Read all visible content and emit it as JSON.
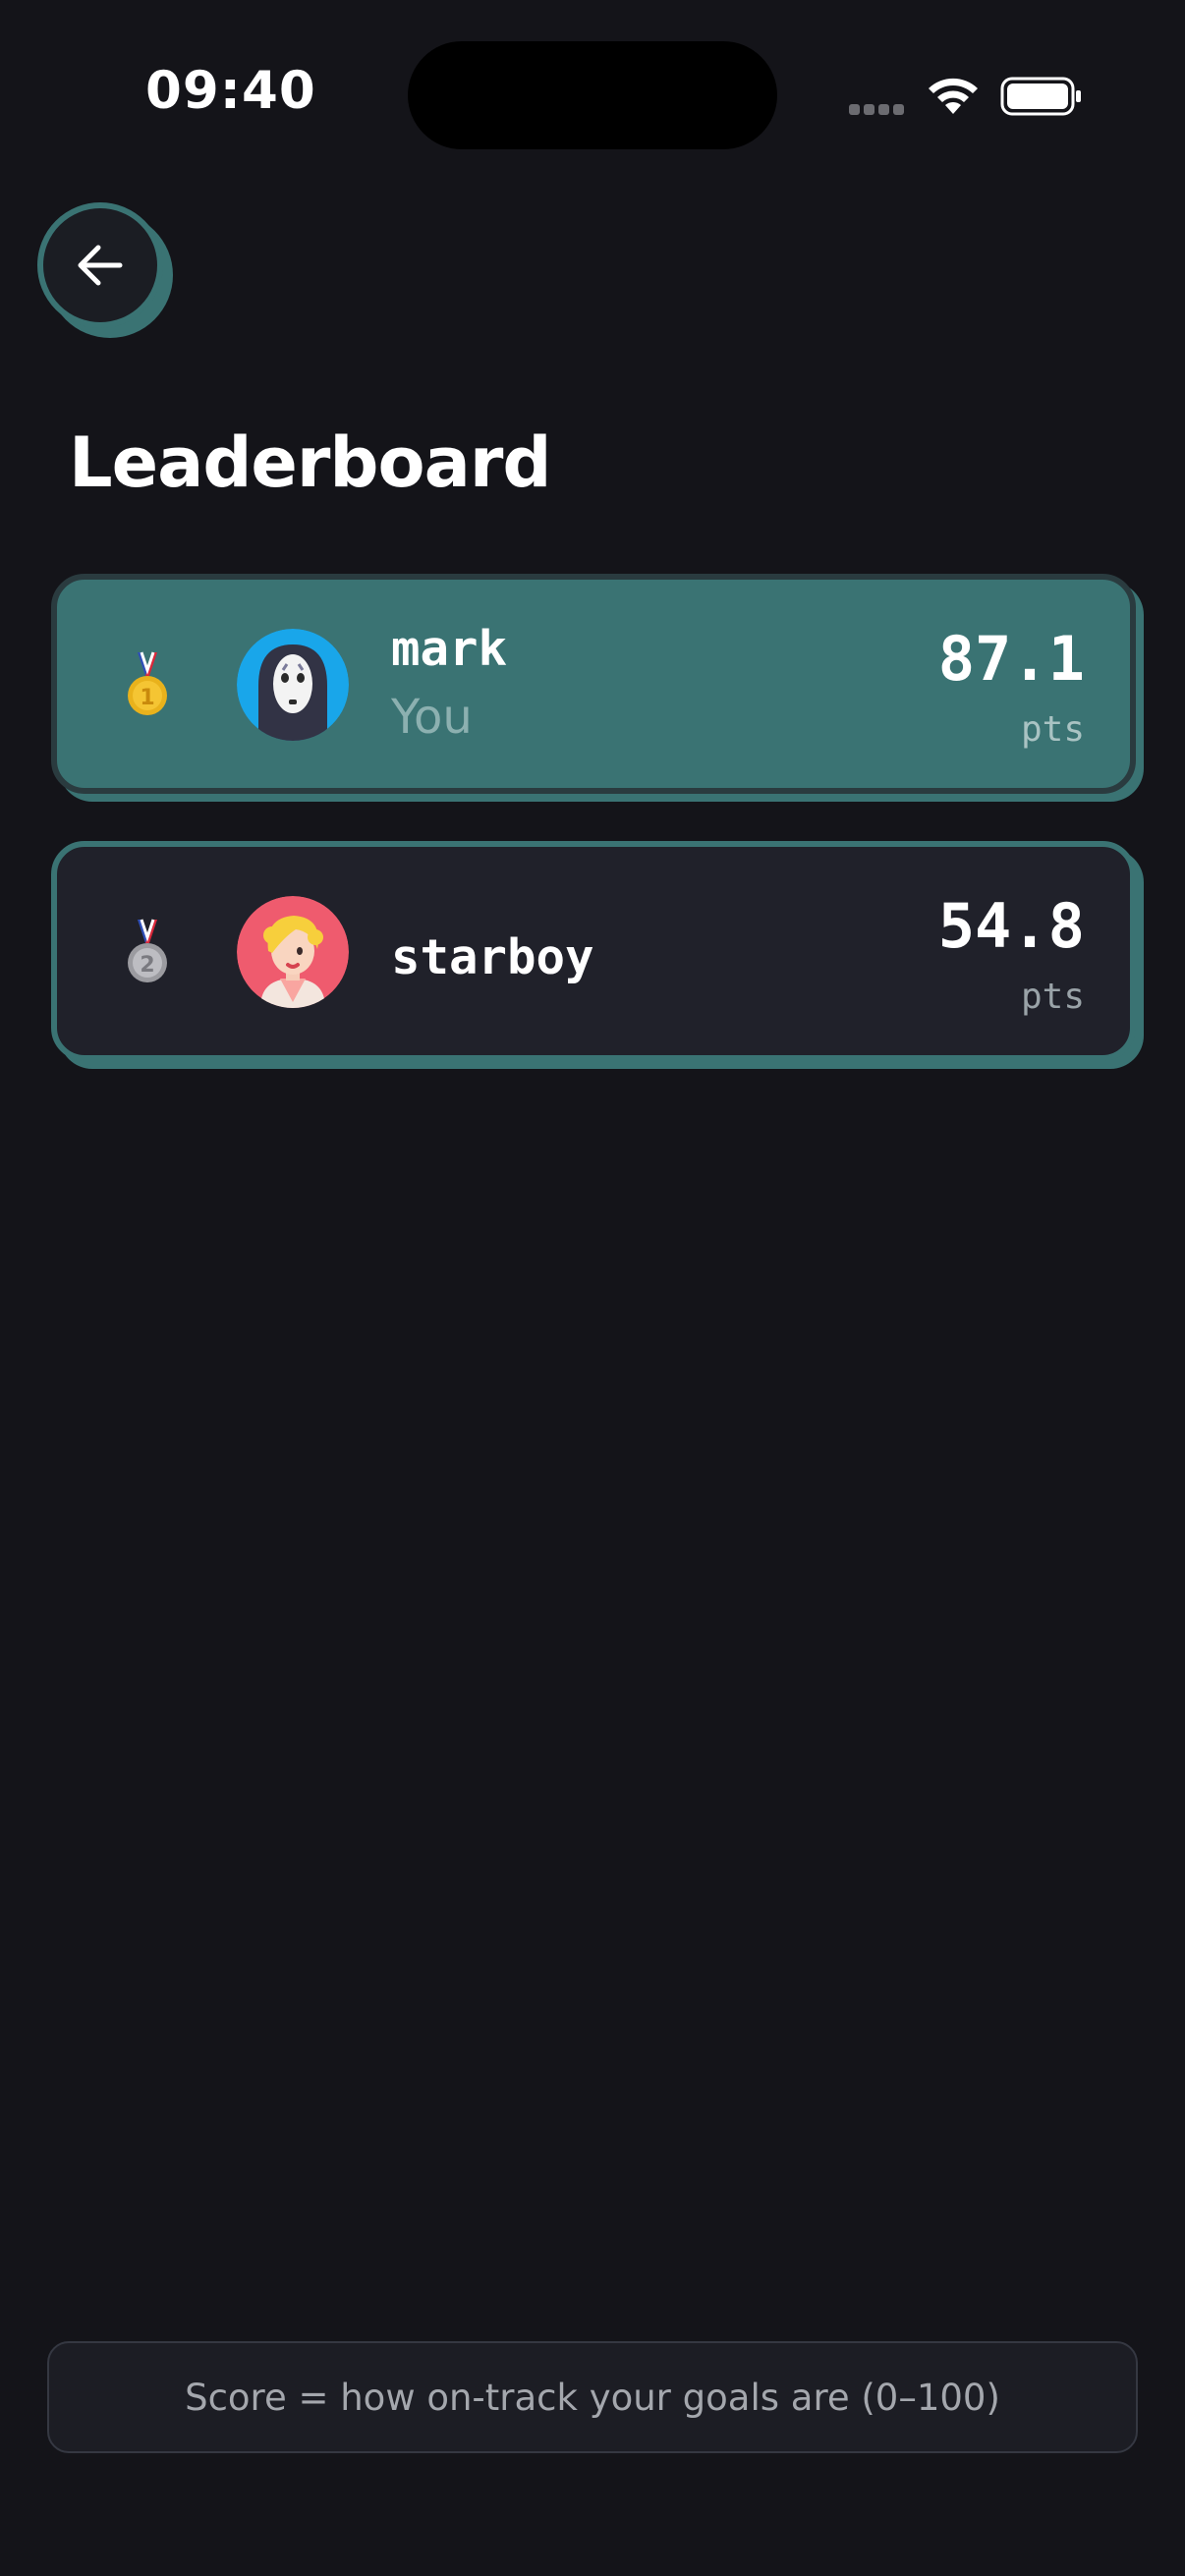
{
  "status_bar": {
    "time": "09:40"
  },
  "header": {
    "title": "Leaderboard"
  },
  "leaderboard": [
    {
      "rank": 1,
      "medal": "gold-medal-icon",
      "name": "mark",
      "subtitle": "You",
      "score": "87.1",
      "unit": "pts"
    },
    {
      "rank": 2,
      "medal": "silver-medal-icon",
      "name": "starboy",
      "score": "54.8",
      "unit": "pts"
    }
  ],
  "footer": {
    "note": "Score = how on-track your goals are (0–100)"
  },
  "colors": {
    "accent": "#3a7373",
    "background": "#141419",
    "card": "#20212a"
  }
}
